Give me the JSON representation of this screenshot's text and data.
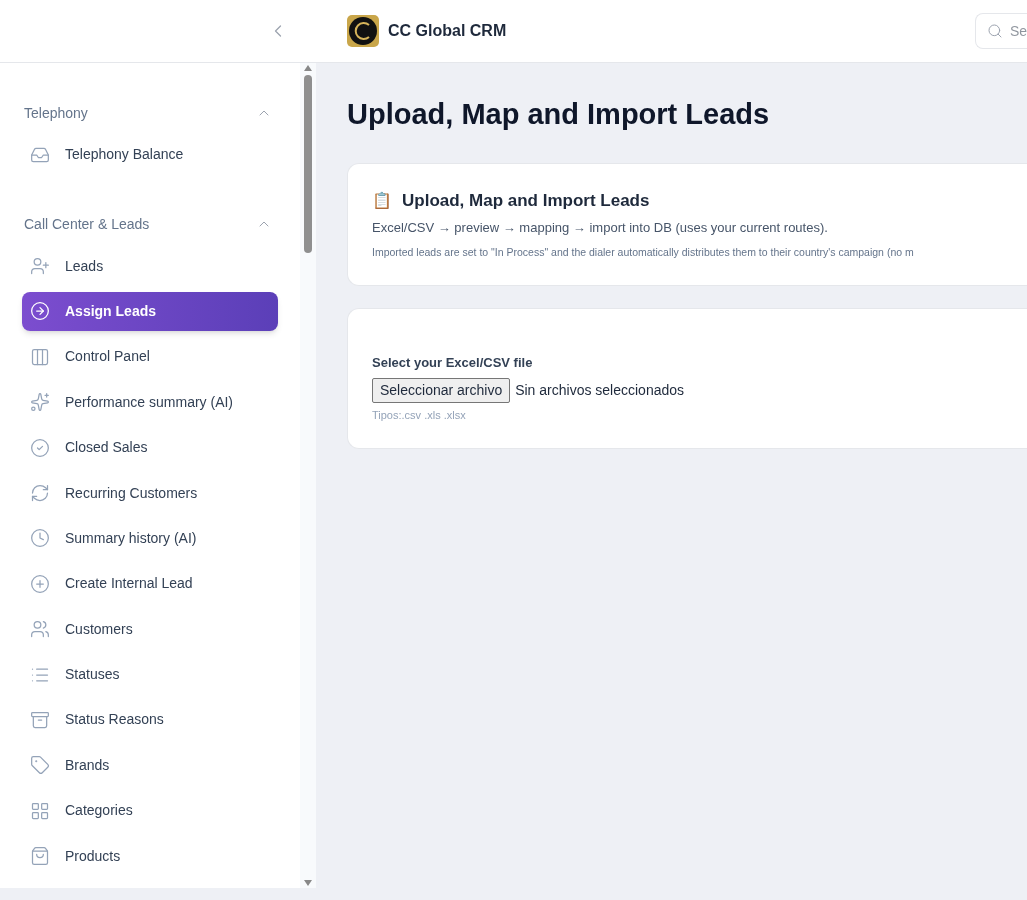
{
  "header": {
    "brand": "CC Global CRM",
    "search": {
      "placeholder": "Se"
    }
  },
  "sidebar": {
    "sections": [
      {
        "title": "Telephony",
        "expanded": true,
        "items": [
          {
            "label": "Telephony Balance",
            "selected": false
          }
        ]
      },
      {
        "title": "Call Center & Leads",
        "expanded": true,
        "items": [
          {
            "label": "Leads",
            "selected": false
          },
          {
            "label": "Assign Leads",
            "selected": true
          },
          {
            "label": "Control Panel",
            "selected": false
          },
          {
            "label": "Performance summary (AI)",
            "selected": false
          },
          {
            "label": "Closed Sales",
            "selected": false
          },
          {
            "label": "Recurring Customers",
            "selected": false
          },
          {
            "label": "Summary history (AI)",
            "selected": false
          },
          {
            "label": "Create Internal Lead",
            "selected": false
          },
          {
            "label": "Customers",
            "selected": false
          },
          {
            "label": "Statuses",
            "selected": false
          },
          {
            "label": "Status Reasons",
            "selected": false
          },
          {
            "label": "Brands",
            "selected": false
          },
          {
            "label": "Categories",
            "selected": false
          },
          {
            "label": "Products",
            "selected": false
          }
        ]
      }
    ]
  },
  "page": {
    "title": "Upload, Map and Import Leads",
    "info_card": {
      "icon": "📋",
      "title": "Upload, Map and Import Leads",
      "subtitle": "Excel/CSV → preview → mapping → import into DB (uses your current routes).",
      "note": "Imported leads are set to \"In Process\" and the dialer automatically distributes them to their country's campaign (no m"
    },
    "upload_card": {
      "label": "Select your Excel/CSV file",
      "button": "Seleccionar archivo",
      "status": "Sin archivos seleccionados",
      "hint": "Tipos:.csv .xls .xlsx"
    }
  }
}
